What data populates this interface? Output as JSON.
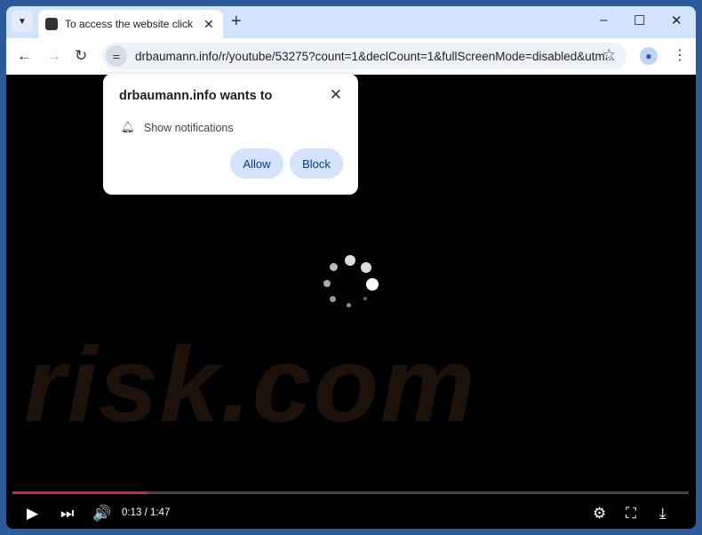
{
  "tab": {
    "title": "To access the website click the \"Allow\" button",
    "close": "✕",
    "new_tab": "+"
  },
  "window_controls": {
    "minimize": "–",
    "maximize": "☐",
    "close": "✕"
  },
  "toolbar": {
    "url": "drbaumann.info/r/youtube/53275?count=1&declCount=1&fullScreenMode=disabled&utm..."
  },
  "popup": {
    "title": "drbaumann.info wants to",
    "permission": "Show notifications",
    "allow": "Allow",
    "block": "Block"
  },
  "player": {
    "time": "0:13 / 1:47",
    "progress_percent": 20
  },
  "watermark": "risk.com",
  "colors": {
    "accent": "#d3e3fd",
    "progress": "#c82d2d",
    "frame": "#2c5b9c"
  }
}
